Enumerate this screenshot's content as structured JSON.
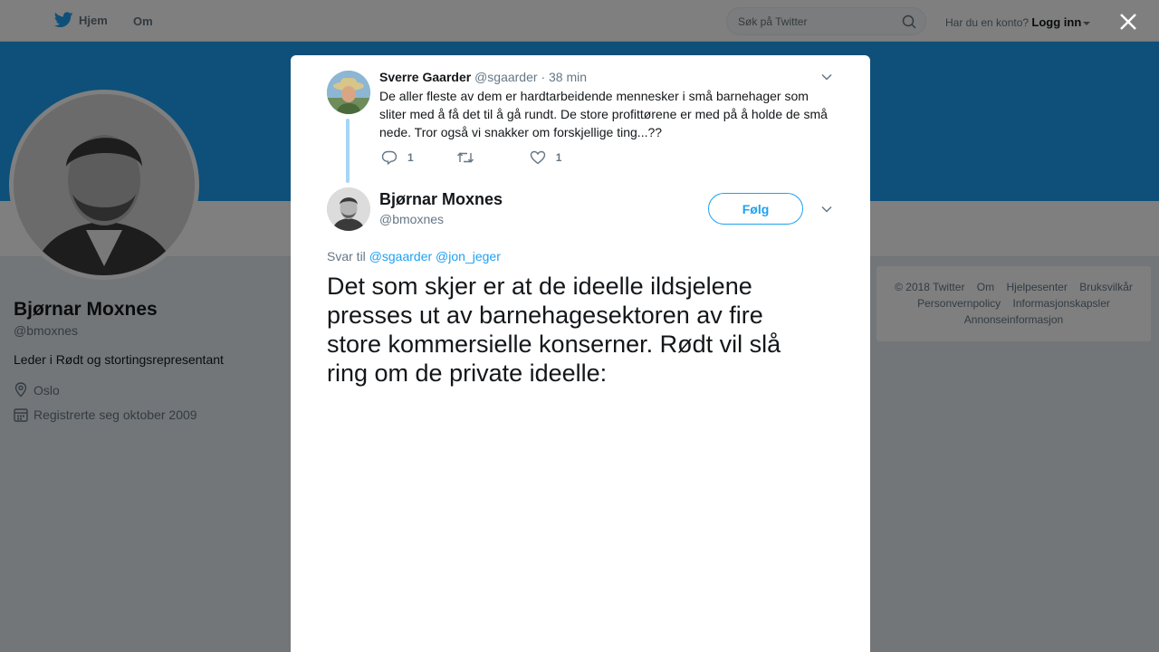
{
  "topbar": {
    "home_label": "Hjem",
    "about_label": "Om",
    "search_placeholder": "Søk på Twitter",
    "login_question": "Har du en konto?",
    "login_label": "Logg inn"
  },
  "profile": {
    "name": "Bjørnar Moxnes",
    "handle": "@bmoxnes",
    "bio": "Leder i Rødt og stortingsrepresentant",
    "location": "Oslo",
    "joined": "Registrerte seg oktober 2009"
  },
  "footer": {
    "links": [
      "© 2018 Twitter",
      "Om",
      "Hjelpesenter",
      "Bruksvilkår",
      "Personvernpolicy",
      "Informasjonskapsler",
      "Annonseinformasjon"
    ]
  },
  "parent_tweet": {
    "name": "Sverre Gaarder",
    "handle": "@sgaarder",
    "separator": "·",
    "time": "38 min",
    "text": "De aller fleste av dem er hardtarbeidende mennesker i små barnehager som sliter med å få det til å gå rundt. De store profittørene er med på å holde de små nede. Tror også vi snakker om forskjellige ting...??",
    "reply_count": "1",
    "like_count": "1"
  },
  "main_tweet": {
    "name": "Bjørnar Moxnes",
    "handle": "@bmoxnes",
    "follow_label": "Følg",
    "reply_prefix": "Svar til",
    "reply_mentions": [
      "@sgaarder",
      "@jon_jeger"
    ],
    "text": "Det som skjer er at de ideelle ildsjelene presses ut av barnehagesektoren av fire store kommersielle konserner. Rødt vil slå ring om de private ideelle:"
  },
  "colors": {
    "brand_blue": "#1da1f2",
    "thread_line": "#a5d6f5",
    "muted_text": "#657786"
  }
}
